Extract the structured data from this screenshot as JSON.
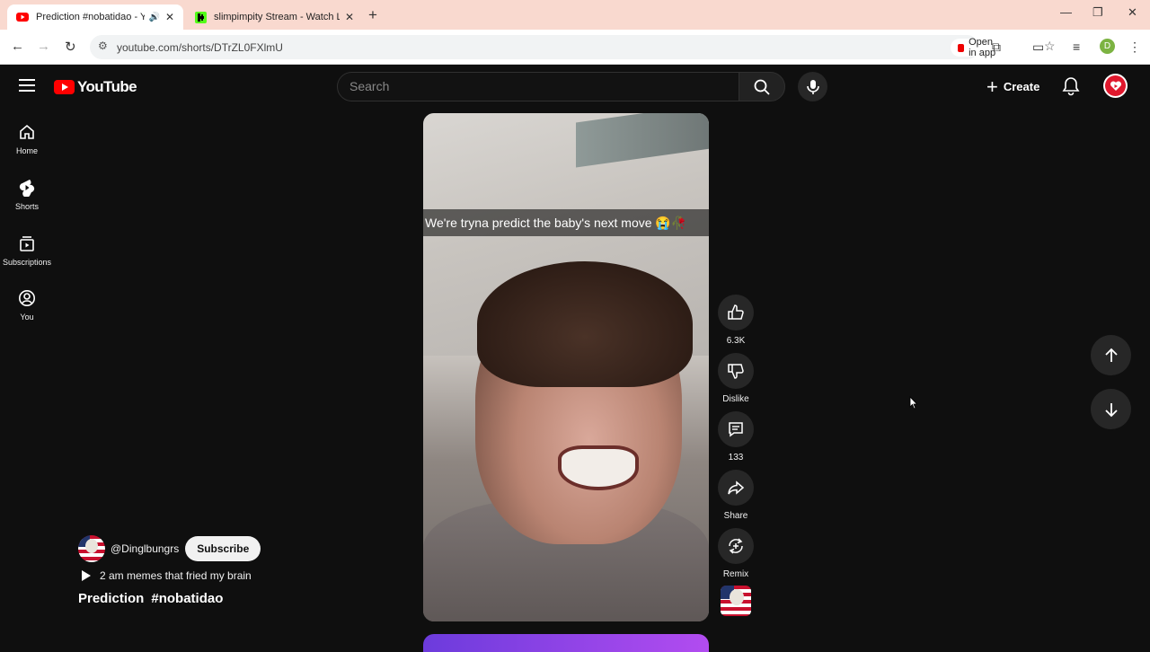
{
  "browser": {
    "tabs": [
      {
        "title": "Prediction #nobatidao - You",
        "active": true,
        "favicon": "youtube-icon"
      },
      {
        "title": "slimpimpity Stream - Watch Liv",
        "active": false,
        "favicon": "kick-icon"
      }
    ],
    "url": "youtube.com/shorts/DTrZL0FXlmU",
    "open_in_app": "Open in app",
    "profile_initial": "D"
  },
  "header": {
    "logo_text": "YouTube",
    "search_placeholder": "Search",
    "create_label": "Create"
  },
  "guide": [
    {
      "label": "Home",
      "icon": "home-icon"
    },
    {
      "label": "Shorts",
      "icon": "shorts-icon"
    },
    {
      "label": "Subscriptions",
      "icon": "subscriptions-icon"
    },
    {
      "label": "You",
      "icon": "you-icon"
    }
  ],
  "short": {
    "caption": "We're tryna predict the baby's next move 😭🥀",
    "channel_handle": "@Dinglbungrs",
    "subscribe_label": "Subscribe",
    "playlist": "2 am memes that fried my brain",
    "title_words": [
      "Prediction",
      "#nobatidao"
    ]
  },
  "actions": {
    "like_count": "6.3K",
    "dislike_label": "Dislike",
    "comment_count": "133",
    "share_label": "Share",
    "remix_label": "Remix"
  },
  "colors": {
    "background": "#0f0f0f",
    "accent": "#ff0000",
    "tabbar": "#f9d9cf"
  }
}
